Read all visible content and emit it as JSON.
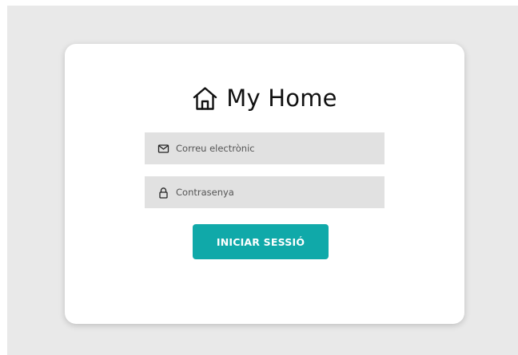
{
  "brand": {
    "icon": "house-icon",
    "title": "My Home"
  },
  "form": {
    "email": {
      "icon": "envelope-icon",
      "placeholder": "Correu electrònic",
      "value": ""
    },
    "password": {
      "icon": "lock-icon",
      "placeholder": "Contrasenya",
      "value": ""
    },
    "submit_label": "INICIAR SESSIÓ"
  },
  "colors": {
    "background": "#e9e9e9",
    "card": "#ffffff",
    "field": "#e1e1e1",
    "accent": "#10a9a9",
    "text": "#111111"
  }
}
